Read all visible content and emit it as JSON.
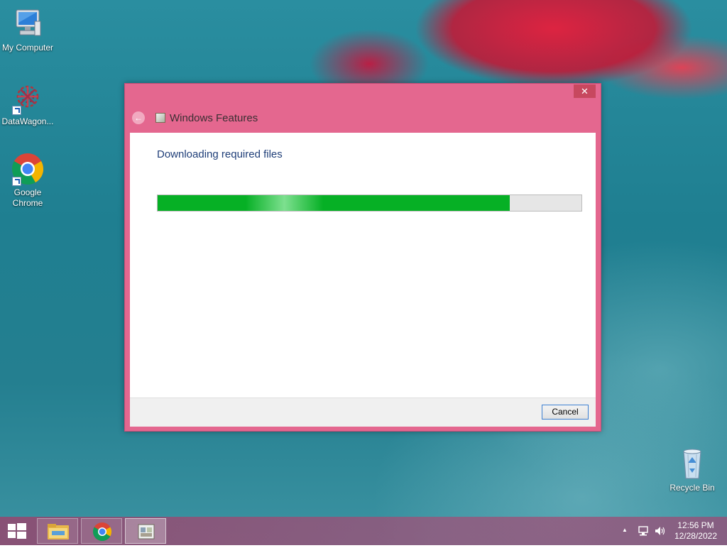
{
  "desktop": {
    "icons": [
      {
        "label": "My Computer",
        "icon": "computer-icon"
      },
      {
        "label": "DataWagon...",
        "icon": "datawagon-icon"
      },
      {
        "label": "Google Chrome",
        "icon": "chrome-icon"
      },
      {
        "label": "Recycle Bin",
        "icon": "recycle-bin-icon"
      }
    ]
  },
  "dialog": {
    "title": "Windows Features",
    "close_label": "✕",
    "back_label": "←",
    "heading": "Downloading required files",
    "progress_fraction": 0.83,
    "cancel_label": "Cancel",
    "colors": {
      "frame": "#e4678f",
      "progress": "#06b025",
      "heading": "#1f3e78"
    }
  },
  "taskbar": {
    "pinned": [
      {
        "name": "file-explorer",
        "icon": "folder-icon"
      },
      {
        "name": "google-chrome",
        "icon": "chrome-icon"
      },
      {
        "name": "windows-features",
        "icon": "windows-features-icon",
        "active": true
      }
    ],
    "tray": {
      "overflow_label": "▲",
      "time": "12:56 PM",
      "date": "12/28/2022"
    }
  }
}
